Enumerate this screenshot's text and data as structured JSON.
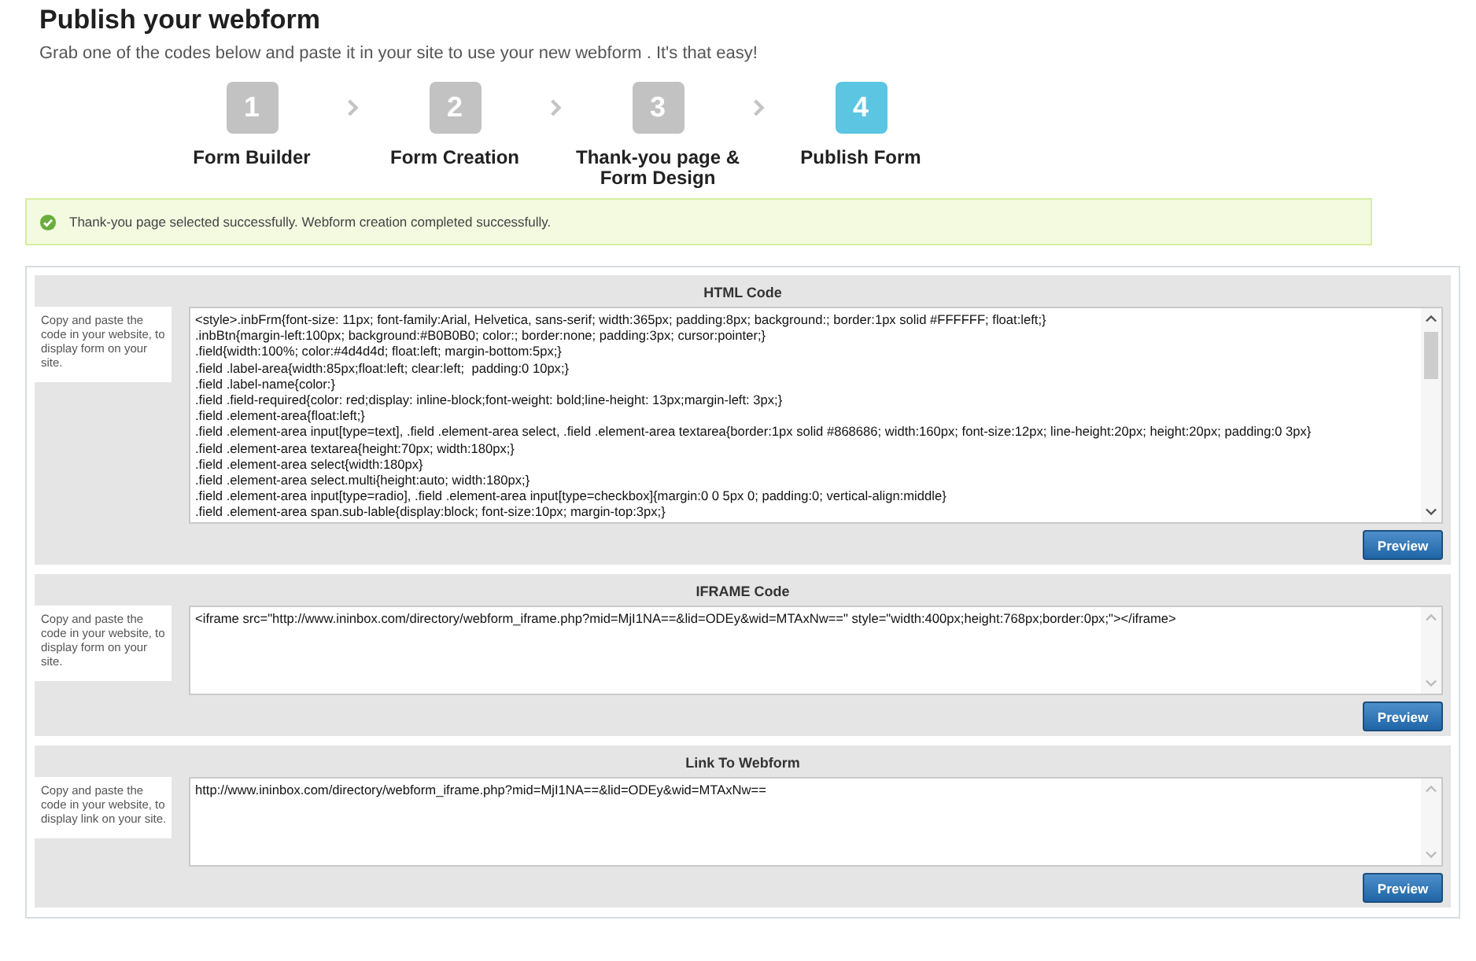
{
  "page": {
    "title": "Publish your webform",
    "subtitle": "Grab one of the codes below and paste it in your site to use your new webform . It's that easy!"
  },
  "steps": [
    {
      "number": "1",
      "label": "Form Builder",
      "selected": false
    },
    {
      "number": "2",
      "label": "Form Creation",
      "selected": false
    },
    {
      "number": "3",
      "label": "Thank-you page & Form Design",
      "selected": false
    },
    {
      "number": "4",
      "label": "Publish Form",
      "selected": true
    }
  ],
  "alert": {
    "message": "Thank-you page selected successfully. Webform creation completed successfully."
  },
  "sections": [
    {
      "heading": "HTML Code",
      "instructions": "Copy and paste the code in your website, to display form on your site.",
      "scrollable": true,
      "code_lines": [
        "<style>.inbFrm{font-size: 11px; font-family:Arial, Helvetica, sans-serif; width:365px; padding:8px; background:; border:1px solid #FFFFFF; float:left;}",
        ".inbBtn{margin-left:100px; background:#B0B0B0; color:; border:none; padding:3px; cursor:pointer;}",
        ".field{width:100%; color:#4d4d4d; float:left; margin-bottom:5px;}",
        ".field .label-area{width:85px;float:left; clear:left;  padding:0 10px;}",
        ".field .label-name{color:}",
        ".field .field-required{color: red;display: inline-block;font-weight: bold;line-height: 13px;margin-left: 3px;}",
        ".field .element-area{float:left;}",
        ".field .element-area input[type=text], .field .element-area select, .field .element-area textarea{border:1px solid #868686; width:160px; font-size:12px; line-height:20px; height:20px; padding:0 3px}",
        ".field .element-area textarea{height:70px; width:180px;}",
        ".field .element-area select{width:180px}",
        ".field .element-area select.multi{height:auto; width:180px;}",
        ".field .element-area input[type=radio], .field .element-area input[type=checkbox]{margin:0 0 5px 0; padding:0; vertical-align:middle}",
        ".field .element-area span.sub-lable{display:block; font-size:10px; margin-top:3px;}"
      ],
      "button": "Preview"
    },
    {
      "heading": "IFRAME Code",
      "instructions": "Copy and paste the code in your website, to display form on your site.",
      "scrollable": false,
      "code_lines": [
        "<iframe src=\"http://www.ininbox.com/directory/webform_iframe.php?mid=MjI1NA==&lid=ODEy&wid=MTAxNw==\" style=\"width:400px;height:768px;border:0px;\"></iframe>"
      ],
      "button": "Preview"
    },
    {
      "heading": "Link To Webform",
      "instructions": "Copy and paste the code in your website, to display link on your site.",
      "scrollable": false,
      "code_lines": [
        "http://www.ininbox.com/directory/webform_iframe.php?mid=MjI1NA==&lid=ODEy&wid=MTAxNw=="
      ],
      "button": "Preview"
    }
  ]
}
